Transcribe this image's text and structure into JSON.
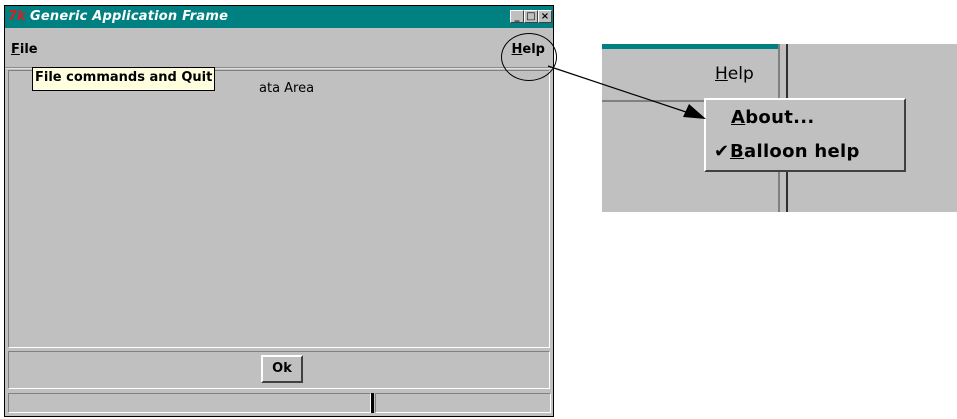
{
  "window": {
    "title": "Generic Application Frame",
    "logo": "7k",
    "controls": {
      "minimize": "_",
      "maximize": "□",
      "close": "×"
    }
  },
  "menubar": {
    "file": {
      "underline": "F",
      "rest": "ile"
    },
    "help": {
      "underline": "H",
      "rest": "elp"
    }
  },
  "tooltip": {
    "text": "File commands and Quit"
  },
  "data_area": {
    "label_visible": "ata Area"
  },
  "button_bar": {
    "ok_label": "Ok"
  },
  "zoom": {
    "help": {
      "underline": "H",
      "rest": "elp"
    },
    "menu_items": [
      {
        "underline": "A",
        "rest": "bout...",
        "checked": false
      },
      {
        "underline": "B",
        "rest": "alloon help",
        "checked": true,
        "check_glyph": "✔"
      }
    ]
  },
  "colors": {
    "titlebar": "#008080",
    "window_bg": "#c0c0c0",
    "tooltip_bg": "#ffffe0",
    "logo": "#d42020"
  }
}
